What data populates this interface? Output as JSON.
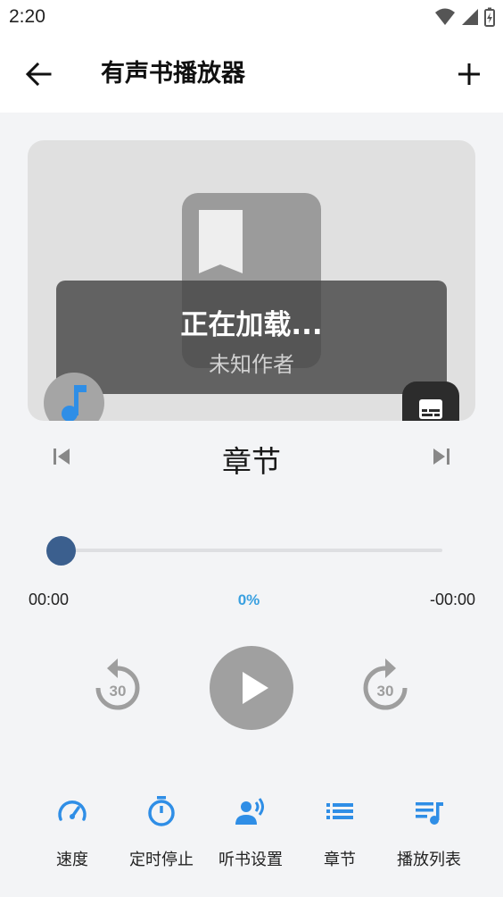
{
  "status": {
    "time": "2:20"
  },
  "app_bar": {
    "title": "有声书播放器"
  },
  "cover": {
    "title": "正在加载...",
    "author": "未知作者"
  },
  "player": {
    "chapter_title": "章节",
    "elapsed": "00:00",
    "percent": "0%",
    "remaining": "-00:00",
    "progress_fraction": 0,
    "skip_seconds_back": "30",
    "skip_seconds_forward": "30"
  },
  "actions": [
    {
      "label": "速度",
      "icon": "speedometer-icon"
    },
    {
      "label": "定时停止",
      "icon": "timer-icon"
    },
    {
      "label": "听书设置",
      "icon": "voice-settings-icon"
    },
    {
      "label": "章节",
      "icon": "list-icon"
    },
    {
      "label": "播放列表",
      "icon": "playlist-icon"
    }
  ],
  "colors": {
    "accent": "#3aa0e0",
    "seek_thumb": "#3b5f8e",
    "play_button": "#a0a0a0"
  }
}
